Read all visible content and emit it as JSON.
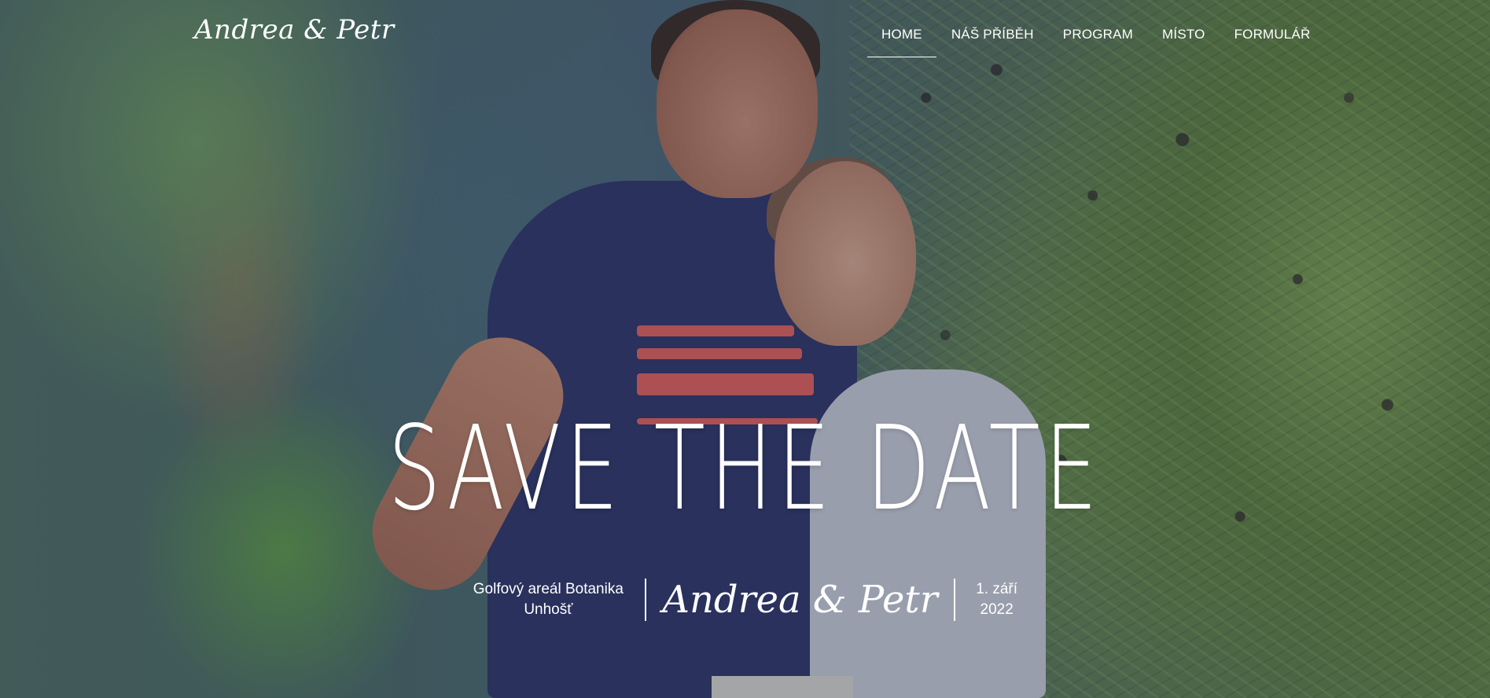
{
  "brand": {
    "logo_text": "Andrea & Petr"
  },
  "nav": {
    "items": [
      {
        "label": "HOME",
        "active": true
      },
      {
        "label": "NÁŠ PŘÍBĚH",
        "active": false
      },
      {
        "label": "PROGRAM",
        "active": false
      },
      {
        "label": "MÍSTO",
        "active": false
      },
      {
        "label": "FORMULÁŘ",
        "active": false
      }
    ]
  },
  "hero": {
    "headline": "Save the date",
    "location_line1": "Golfový areál Botanika",
    "location_line2": "Unhošť",
    "couple_names": "Andrea & Petr",
    "date_line1": "1. září",
    "date_line2": "2022"
  },
  "colors": {
    "overlay": "#1c2846",
    "text": "#ffffff",
    "nav_underline": "#ffffff"
  }
}
